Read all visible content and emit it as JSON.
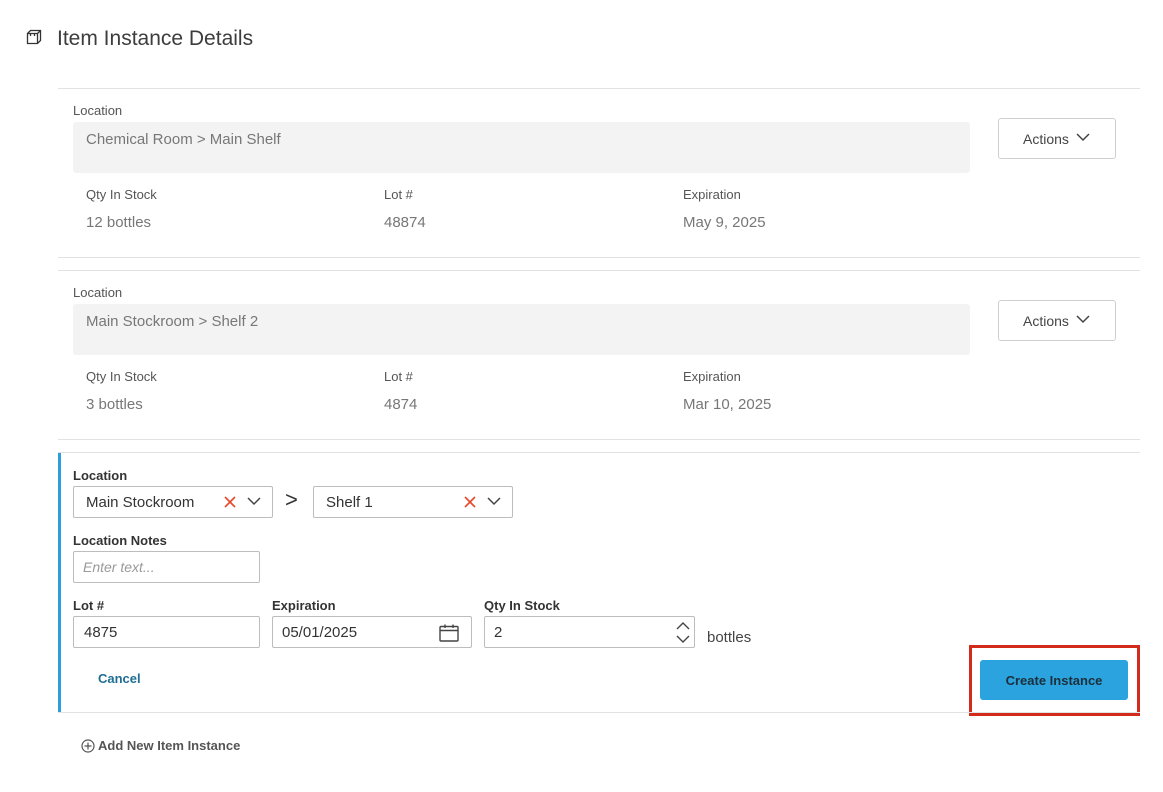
{
  "header": {
    "title": "Item Instance Details",
    "icon": "box-icon"
  },
  "instances": [
    {
      "location_label": "Location",
      "location": "Chemical Room > Main Shelf",
      "actions_label": "Actions",
      "qty_label": "Qty In Stock",
      "qty": "12 bottles",
      "lot_label": "Lot #",
      "lot": "48874",
      "exp_label": "Expiration",
      "exp": "May 9, 2025"
    },
    {
      "location_label": "Location",
      "location": "Main Stockroom > Shelf 2",
      "actions_label": "Actions",
      "qty_label": "Qty In Stock",
      "qty": "3 bottles",
      "lot_label": "Lot #",
      "lot": "4874",
      "exp_label": "Expiration",
      "exp": "Mar 10, 2025"
    }
  ],
  "form": {
    "location_label": "Location",
    "location_primary": "Main Stockroom",
    "separator": ">",
    "location_secondary": "Shelf 1",
    "notes_label": "Location Notes",
    "notes_placeholder": "Enter text...",
    "lot_label": "Lot #",
    "lot_value": "4875",
    "exp_label": "Expiration",
    "exp_value": "05/01/2025",
    "qty_label": "Qty In Stock",
    "qty_value": "2",
    "qty_unit": "bottles",
    "cancel_label": "Cancel",
    "create_label": "Create Instance"
  },
  "add_new_label": "Add New Item Instance",
  "colors": {
    "accent": "#2ba3df",
    "highlight": "#d22a1b",
    "clear_x": "#e8472a"
  }
}
